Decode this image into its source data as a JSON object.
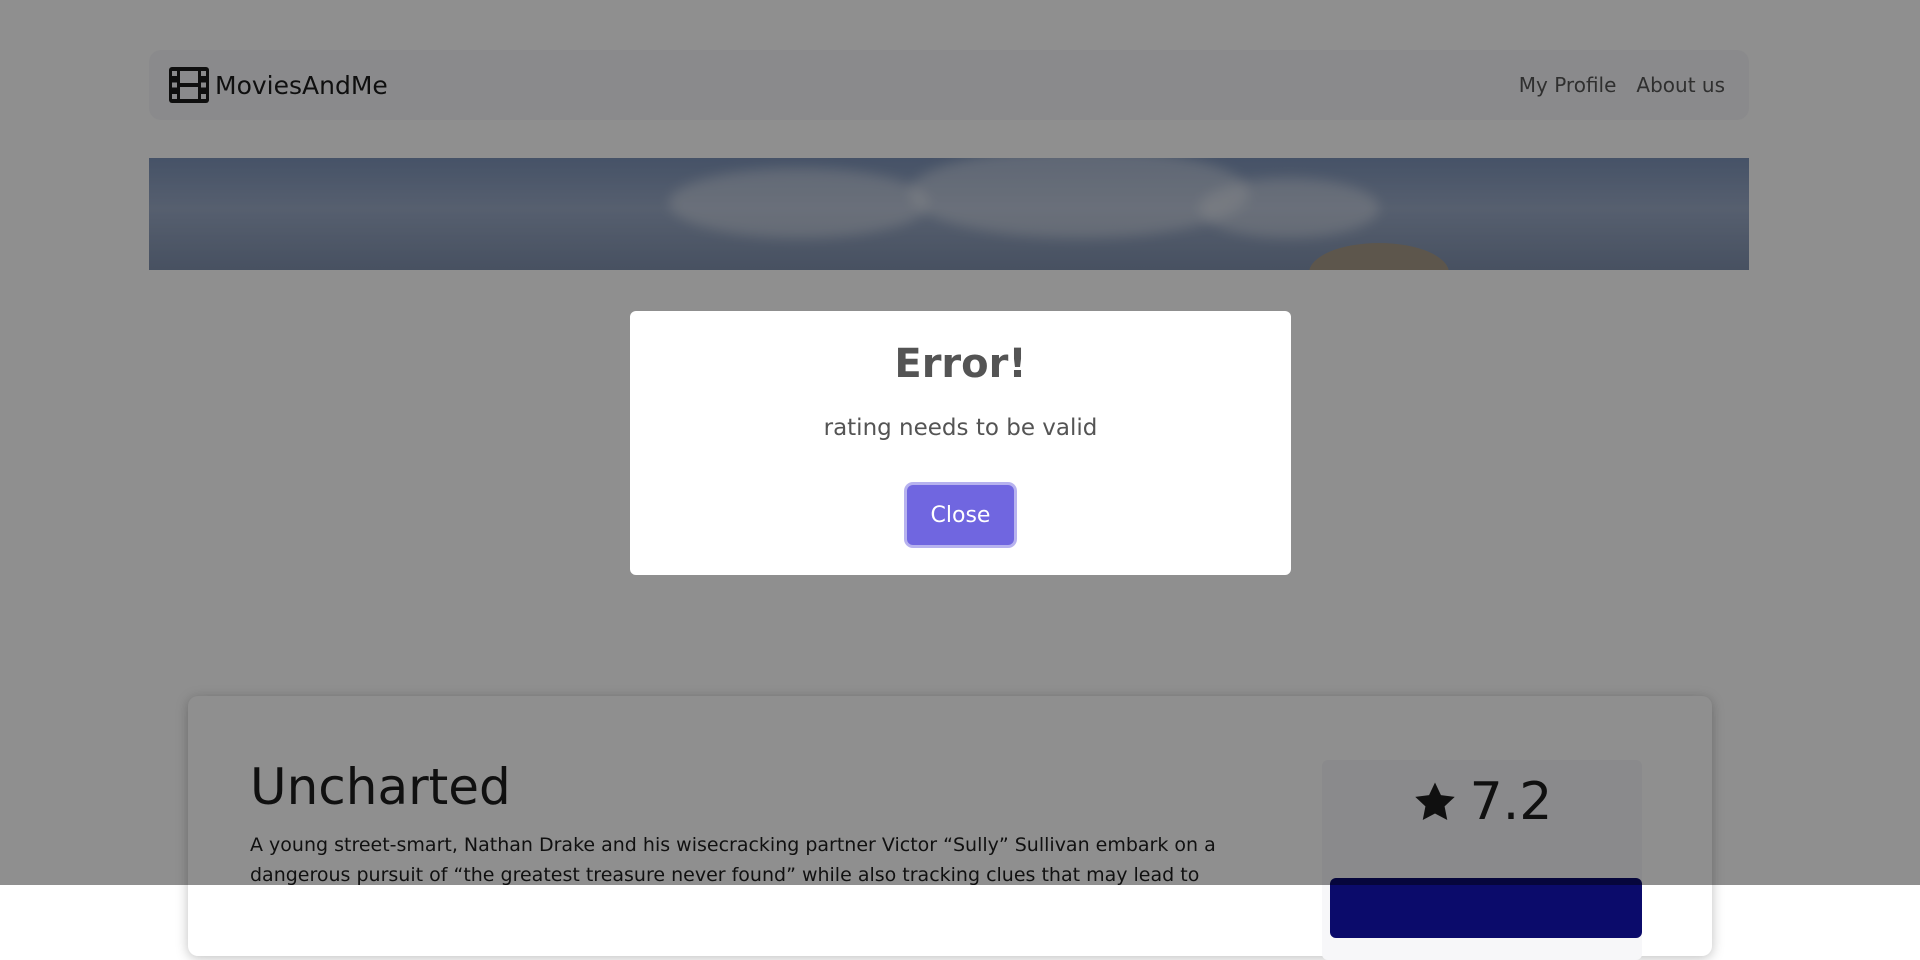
{
  "navbar": {
    "brand_name": "MoviesAndMe",
    "brand_icon": "film-icon",
    "links": [
      {
        "label": "My Profile"
      },
      {
        "label": "About us"
      }
    ]
  },
  "movie": {
    "title": "Uncharted",
    "description": "A young street-smart, Nathan Drake and his wisecracking partner Victor “Sully” Sullivan embark on a dangerous pursuit of “the greatest treasure never found” while also tracking clues that may lead to",
    "rating": "7.2",
    "rating_icon": "star-icon"
  },
  "modal": {
    "title": "Error!",
    "message": "rating needs to be valid",
    "close_label": "Close"
  },
  "colors": {
    "accent": "#7066e0",
    "overlay": "rgba(0,0,0,0.44)",
    "rate_button": "#0b0b6b"
  }
}
